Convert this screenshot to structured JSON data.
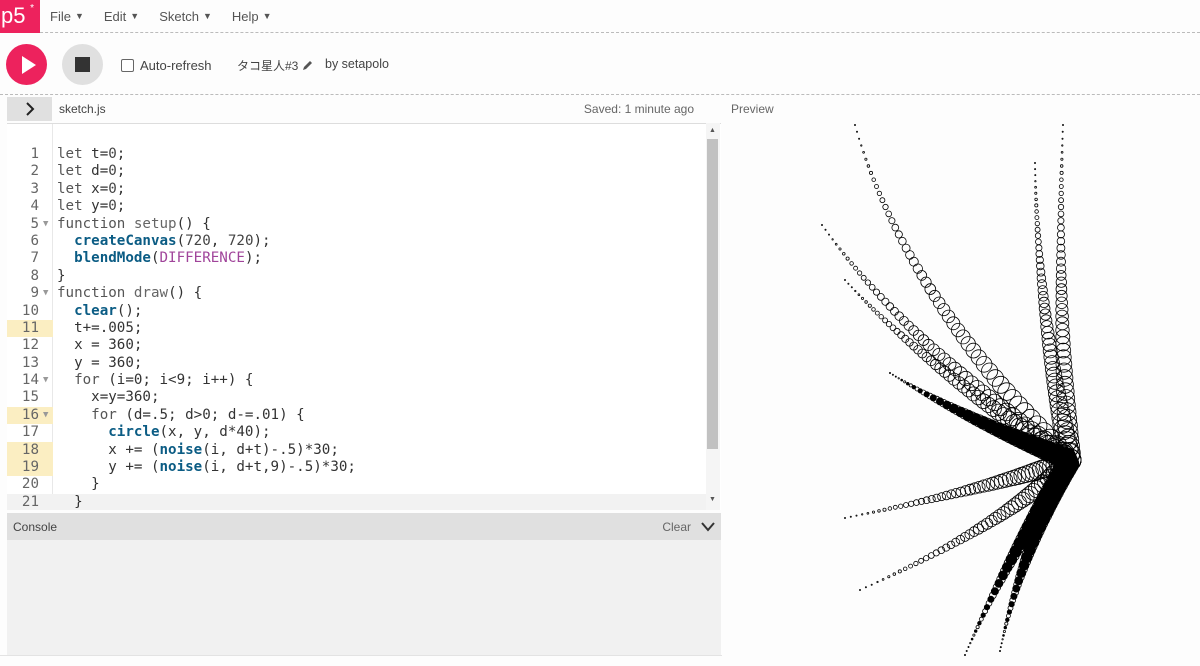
{
  "menubar": {
    "logo": "p5",
    "logo_sup": "*",
    "items": [
      {
        "label": "File"
      },
      {
        "label": "Edit"
      },
      {
        "label": "Sketch"
      },
      {
        "label": "Help"
      }
    ]
  },
  "toolbar": {
    "auto_refresh_label": "Auto-refresh",
    "auto_refresh_checked": false,
    "sketch_title": "タコ星人#3",
    "author": "by setapolo"
  },
  "editor": {
    "file_name": "sketch.js",
    "saved_status": "Saved: 1 minute ago",
    "highlighted_lines": [
      11,
      16,
      18,
      19
    ],
    "folded_lines": [
      5,
      9,
      14,
      16
    ],
    "lines": [
      [
        [
          "let",
          "kw"
        ],
        [
          " t=",
          "p"
        ],
        [
          "0",
          "num"
        ],
        [
          ";",
          "p"
        ]
      ],
      [
        [
          "let",
          "kw"
        ],
        [
          " d=",
          "p"
        ],
        [
          "0",
          "num"
        ],
        [
          ";",
          "p"
        ]
      ],
      [
        [
          "let",
          "kw"
        ],
        [
          " x=",
          "p"
        ],
        [
          "0",
          "num"
        ],
        [
          ";",
          "p"
        ]
      ],
      [
        [
          "let",
          "kw"
        ],
        [
          " y=",
          "p"
        ],
        [
          "0",
          "num"
        ],
        [
          ";",
          "p"
        ]
      ],
      [
        [
          "function",
          "kw"
        ],
        [
          " ",
          "p"
        ],
        [
          "setup",
          "fn"
        ],
        [
          "() {",
          "p"
        ]
      ],
      [
        [
          "  ",
          "p"
        ],
        [
          "createCanvas",
          "bi"
        ],
        [
          "(",
          "p"
        ],
        [
          "720",
          "num"
        ],
        [
          ", ",
          "p"
        ],
        [
          "720",
          "num"
        ],
        [
          ");",
          "p"
        ]
      ],
      [
        [
          "  ",
          "p"
        ],
        [
          "blendMode",
          "bi"
        ],
        [
          "(",
          "p"
        ],
        [
          "DIFFERENCE",
          "cst"
        ],
        [
          ");",
          "p"
        ]
      ],
      [
        [
          "}",
          "p"
        ]
      ],
      [
        [
          "function",
          "kw"
        ],
        [
          " ",
          "p"
        ],
        [
          "draw",
          "fn"
        ],
        [
          "() {",
          "p"
        ]
      ],
      [
        [
          "  ",
          "p"
        ],
        [
          "clear",
          "bi"
        ],
        [
          "();",
          "p"
        ]
      ],
      [
        [
          "  t+=.005;",
          "p"
        ]
      ],
      [
        [
          "  x = 360;",
          "p"
        ]
      ],
      [
        [
          "  y = 360;",
          "p"
        ]
      ],
      [
        [
          "  ",
          "p"
        ],
        [
          "for",
          "kw"
        ],
        [
          " (i=0; i<9; i++) {",
          "p"
        ]
      ],
      [
        [
          "    x=y=360;",
          "p"
        ]
      ],
      [
        [
          "    ",
          "p"
        ],
        [
          "for",
          "kw"
        ],
        [
          " (d=.5; d>0; d-=.01) {",
          "p"
        ]
      ],
      [
        [
          "      ",
          "p"
        ],
        [
          "circle",
          "bi"
        ],
        [
          "(x, y, d*40);",
          "p"
        ]
      ],
      [
        [
          "      x += (",
          "p"
        ],
        [
          "noise",
          "bi"
        ],
        [
          "(i, d+t)-.5)*30;",
          "p"
        ]
      ],
      [
        [
          "      y += (",
          "p"
        ],
        [
          "noise",
          "bi"
        ],
        [
          "(i, d+t,9)-.5)*30;",
          "p"
        ]
      ],
      [
        [
          "    }",
          "p"
        ]
      ],
      [
        [
          "  }",
          "p"
        ]
      ]
    ]
  },
  "preview": {
    "label": "Preview"
  },
  "console": {
    "label": "Console",
    "clear_label": "Clear"
  },
  "colors": {
    "accent": "#ed225d",
    "highlight_line": "#fbeec2",
    "builtin": "#0b5c84",
    "constant": "#a0449a"
  },
  "icons": {
    "play": "play-icon",
    "stop": "stop-icon",
    "expand": "chevron-right-icon",
    "edit": "pencil-icon",
    "collapse": "chevron-down-icon"
  }
}
